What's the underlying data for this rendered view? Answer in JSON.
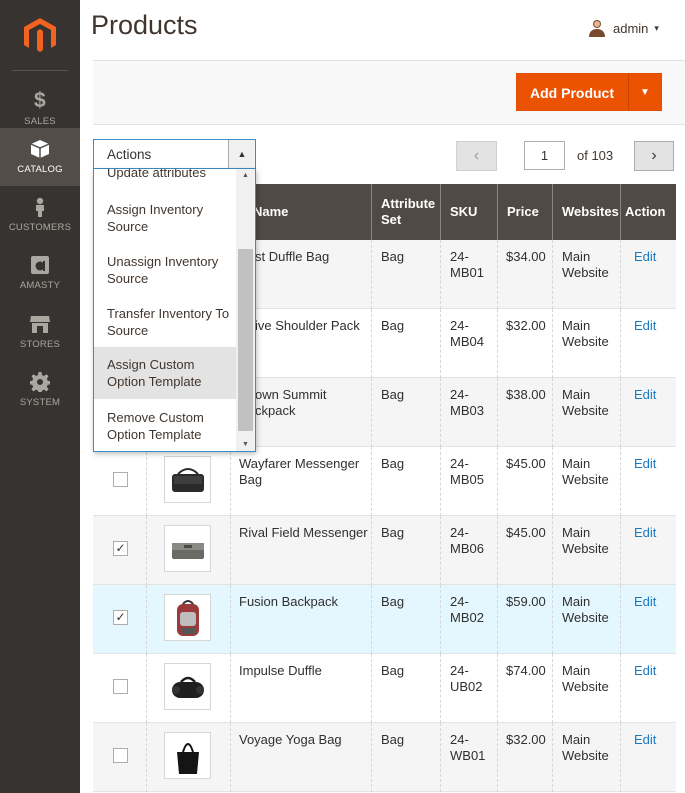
{
  "sidebar": {
    "items": [
      {
        "label": "SALES",
        "icon": "dollar-icon"
      },
      {
        "label": "CATALOG",
        "icon": "box-icon",
        "active": true
      },
      {
        "label": "CUSTOMERS",
        "icon": "person-icon"
      },
      {
        "label": "AMASTY",
        "icon": "amasty-icon"
      },
      {
        "label": "STORES",
        "icon": "store-icon"
      },
      {
        "label": "SYSTEM",
        "icon": "gear-icon"
      }
    ],
    "dollar_glyph": "$"
  },
  "header": {
    "title": "Products",
    "user": "admin"
  },
  "toolbar": {
    "add_product": "Add Product"
  },
  "actions": {
    "label": "Actions",
    "options": [
      "Update attributes",
      "Assign Inventory Source",
      "Unassign Inventory Source",
      "Transfer Inventory To Source",
      "Assign Custom Option Template",
      "Remove Custom Option Template"
    ],
    "highlighted": "Assign Custom Option Template"
  },
  "pager": {
    "current": "1",
    "total_text": "of 103"
  },
  "grid": {
    "columns": [
      "Name",
      "Attribute Set",
      "SKU",
      "Price",
      "Websites",
      "Action"
    ],
    "rows": [
      {
        "name": "Strive Shoulder Pack",
        "name_visible": "ive Shoulder Pack",
        "set": "Bag",
        "sku": "24-MB04",
        "price": "$32.00",
        "website": "Main Website",
        "action": "Edit"
      },
      {
        "name": "Crown Summit Backpack",
        "name_visible": "own Summit ckpack",
        "set": "Bag",
        "sku": "24-MB03",
        "price": "$38.00",
        "website": "Main Website",
        "action": "Edit"
      },
      {
        "name": "Wayfarer Messenger Bag",
        "set": "Bag",
        "sku": "24-MB05",
        "price": "$45.00",
        "website": "Main Website",
        "action": "Edit",
        "checked": false
      },
      {
        "name": "Rival Field Messenger",
        "set": "Bag",
        "sku": "24-MB06",
        "price": "$45.00",
        "website": "Main Website",
        "action": "Edit",
        "checked": true
      },
      {
        "name": "Fusion Backpack",
        "set": "Bag",
        "sku": "24-MB02",
        "price": "$59.00",
        "website": "Main Website",
        "action": "Edit",
        "checked": true
      },
      {
        "name": "Impulse Duffle",
        "set": "Bag",
        "sku": "24-UB02",
        "price": "$74.00",
        "website": "Main Website",
        "action": "Edit",
        "checked": false
      },
      {
        "name": "Voyage Yoga Bag",
        "set": "Bag",
        "sku": "24-WB01",
        "price": "$32.00",
        "website": "Main Website",
        "action": "Edit",
        "checked": false
      }
    ],
    "first_row": {
      "name_visible": "st Duffle Bag",
      "set": "Bag",
      "sku": "24-MB01",
      "price": "$34.00",
      "website": "Main Website",
      "action": "Edit"
    }
  },
  "colors": {
    "sidebar": "#373330",
    "accent": "#eb5202",
    "header": "#514943",
    "link": "#1979c3",
    "selected_row": "#e5f7fe"
  },
  "glyphs": {
    "check": "✓",
    "caret_down": "▾",
    "arrow_up": "▲",
    "arrow_down": "▼",
    "prev": "‹",
    "next": "›"
  }
}
